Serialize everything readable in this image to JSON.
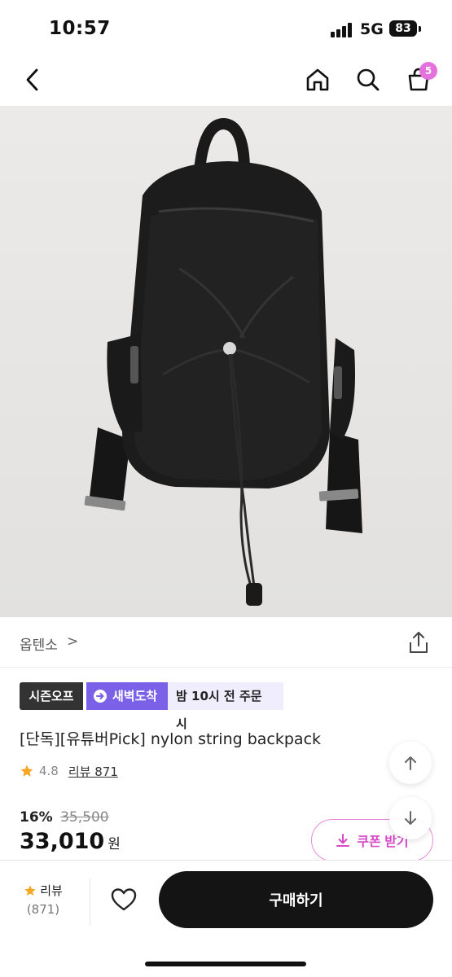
{
  "status": {
    "time": "10:57",
    "network": "5G",
    "battery": "83"
  },
  "nav": {
    "cart_count": "5"
  },
  "product": {
    "brand": "옵텐소",
    "brand_chevron": ">",
    "badges": {
      "season": "시즌오프",
      "dawn": "새벽도착",
      "order": "밤 10시 전 주문 시"
    },
    "title": "[단독][유튜버Pick] nylon string backpack",
    "rating": "4.8",
    "review_link": "리뷰 871",
    "discount_rate": "16%",
    "original_price": "35,500",
    "price": "33,010",
    "currency": "원",
    "coupon_label": "쿠폰 받기"
  },
  "bottom": {
    "review_label": "리뷰",
    "review_count": "(871)",
    "buy_label": "구매하기"
  },
  "colors": {
    "accent_pink": "#d649c8",
    "dawn_purple": "#7b61e8",
    "star": "#f5a623",
    "buy_button": "#141414"
  }
}
